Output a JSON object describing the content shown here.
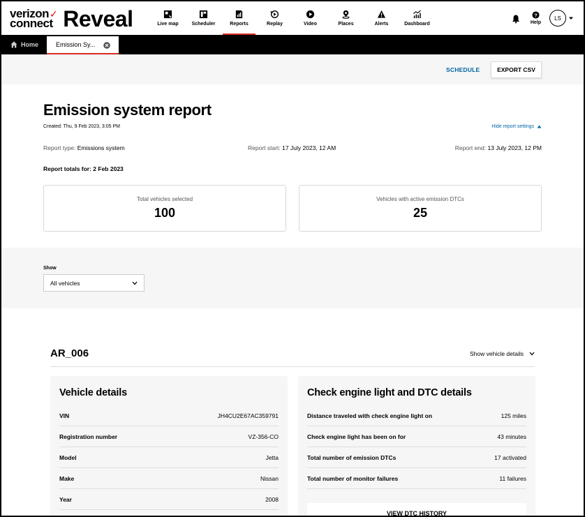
{
  "brand": {
    "top": "verizon",
    "bottom": "connect",
    "product": "Reveal"
  },
  "nav": [
    {
      "label": "Live map",
      "icon": "map-icon"
    },
    {
      "label": "Scheduler",
      "icon": "scheduler-icon"
    },
    {
      "label": "Reports",
      "icon": "reports-icon",
      "active": true
    },
    {
      "label": "Replay",
      "icon": "replay-icon"
    },
    {
      "label": "Video",
      "icon": "video-icon"
    },
    {
      "label": "Places",
      "icon": "places-icon"
    },
    {
      "label": "Alerts",
      "icon": "alerts-icon"
    },
    {
      "label": "Dashboard",
      "icon": "dashboard-icon"
    }
  ],
  "header_right": {
    "help_label": "Help",
    "avatar_initials": "LS"
  },
  "tabs": {
    "home_label": "Home",
    "report_tab_label": "Emission Sy..."
  },
  "actions": {
    "schedule_label": "SCHEDULE",
    "export_label": "EXPORT CSV"
  },
  "report": {
    "title": "Emission system report",
    "created": "Created: Thu, 9 Feb 2023, 3:05 PM",
    "hide_settings_label": "Hide report settings",
    "type_label": "Report type:",
    "type_value": "Emissions system",
    "start_label": "Report start:",
    "start_value": "17 July 2023, 12 AM",
    "end_label": "Report end:",
    "end_value": "13 July 2023, 12 PM",
    "totals_for": "Report totals for: 2 Feb 2023"
  },
  "stats": [
    {
      "label": "Total vehicles selected",
      "value": "100"
    },
    {
      "label": "Vehicles with active emission DTCs",
      "value": "25"
    }
  ],
  "filter": {
    "show_label": "Show",
    "show_value": "All vehicles"
  },
  "vehicle": {
    "name": "AR_006",
    "show_details_label": "Show vehicle details",
    "details_title": "Vehicle details",
    "details": [
      {
        "key": "VIN",
        "value": "JH4CU2E67AC359791"
      },
      {
        "key": "Registration number",
        "value": "VZ-356-CO"
      },
      {
        "key": "Model",
        "value": "Jetta"
      },
      {
        "key": "Make",
        "value": "Nissan"
      },
      {
        "key": "Year",
        "value": "2008"
      }
    ],
    "dtc_title": "Check engine light and DTC details",
    "dtc": [
      {
        "key": "Distance traveled with check engine light on",
        "value": "125 miles"
      },
      {
        "key": "Check engine light has been on for",
        "value": "43 minutes"
      },
      {
        "key": "Total number of emission DTCs",
        "value": "17 activated"
      },
      {
        "key": "Total number of monitor failures",
        "value": "11 failures"
      }
    ],
    "dtc_history_label": "VIEW DTC HISTORY"
  }
}
